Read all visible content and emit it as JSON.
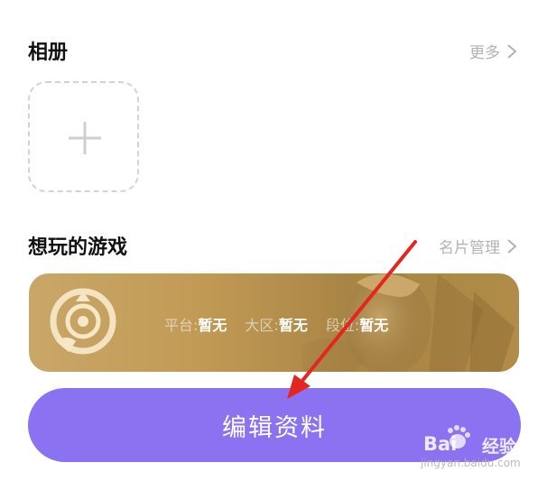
{
  "album": {
    "title": "相册",
    "more_label": "更多"
  },
  "games": {
    "title": "想玩的游戏",
    "manage_label": "名片管理",
    "card": {
      "platform_label": "平台:",
      "platform_value": "暂无",
      "region_label": "大区:",
      "region_value": "暂无",
      "rank_label": "段位:",
      "rank_value": "暂无"
    }
  },
  "edit_button": {
    "label": "编辑资料"
  },
  "watermark": {
    "brand": "Bai",
    "brand_cn": "经验",
    "url": "jingyan.baidu.com"
  },
  "icons": {
    "album_more": "chevron-right-icon",
    "games_more": "chevron-right-icon",
    "add_photo": "plus-icon",
    "game_logo": "game-emblem-icon"
  },
  "colors": {
    "accent": "#8a72f0",
    "card_gold": "#c19a55",
    "annotation_red": "#e5261f",
    "muted_text": "#b3b3b3"
  }
}
